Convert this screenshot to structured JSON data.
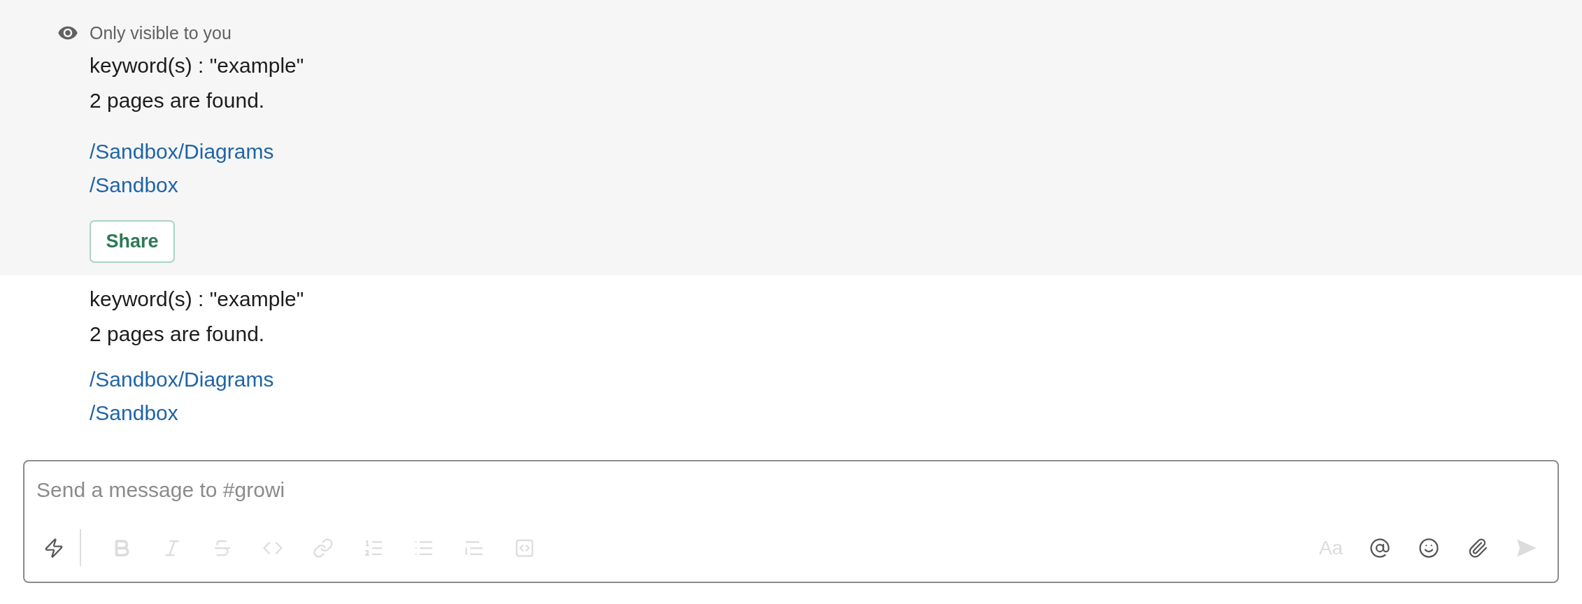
{
  "messages": [
    {
      "ephemeral": true,
      "notice": "Only visible to you",
      "lines": [
        "keyword(s) : \"example\"",
        "2 pages are found."
      ],
      "links": [
        "/Sandbox/Diagrams",
        "/Sandbox"
      ],
      "buttons": [
        "Share"
      ]
    },
    {
      "ephemeral": false,
      "lines": [
        "keyword(s) : \"example\"",
        "2 pages are found."
      ],
      "links": [
        "/Sandbox/Diagrams",
        "/Sandbox"
      ]
    }
  ],
  "composer": {
    "placeholder": "Send a message to #growi",
    "left_tools": [
      {
        "kind": "shortcuts",
        "disabled": false
      }
    ],
    "format_tools": [
      {
        "kind": "bold",
        "disabled": true
      },
      {
        "kind": "italic",
        "disabled": true
      },
      {
        "kind": "strike",
        "disabled": true
      },
      {
        "kind": "code",
        "disabled": true
      },
      {
        "kind": "link",
        "disabled": true
      },
      {
        "kind": "numbered_list",
        "disabled": true
      },
      {
        "kind": "bulleted_list",
        "disabled": true
      },
      {
        "kind": "quote",
        "disabled": true
      },
      {
        "kind": "code_block",
        "disabled": true
      }
    ],
    "actions": [
      {
        "kind": "text_format",
        "label": "Aa",
        "disabled": true
      },
      {
        "kind": "mention",
        "disabled": false
      },
      {
        "kind": "emoji",
        "disabled": false
      },
      {
        "kind": "attach",
        "disabled": false
      },
      {
        "kind": "send",
        "disabled": true
      }
    ]
  }
}
